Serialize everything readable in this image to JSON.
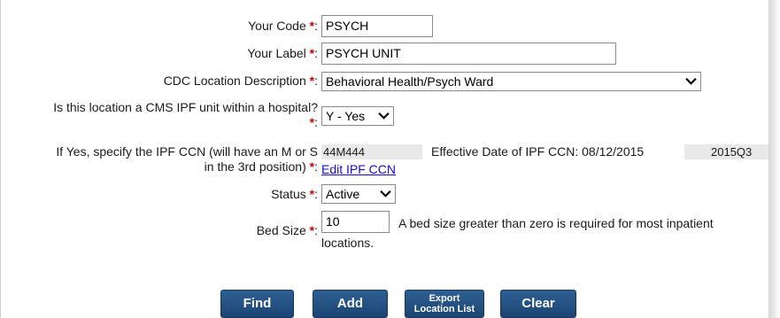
{
  "form": {
    "code": {
      "label": "Your Code",
      "value": "PSYCH"
    },
    "label": {
      "label": "Your Label",
      "value": "PSYCH UNIT"
    },
    "cdc": {
      "label": "CDC Location Description",
      "value": "Behavioral Health/Psych Ward"
    },
    "ipf": {
      "label_line1": "Is this location a CMS IPF unit within a hospital?",
      "value": "Y - Yes"
    },
    "ccn": {
      "label_line1": "If Yes, specify the IPF CCN (will have an M or S",
      "label_line2": "in the 3rd position)",
      "value": "44M444",
      "effective_label": "Effective Date of IPF CCN: 08/12/2015",
      "quarter": "2015Q3",
      "edit_link": "Edit IPF CCN"
    },
    "status": {
      "label": "Status",
      "value": "Active"
    },
    "bed_size": {
      "label": "Bed Size",
      "value": "10",
      "help_line1": "A bed size greater than zero is required for most inpatient",
      "help_line2": "locations."
    },
    "required_marker": "*",
    "colon": ":"
  },
  "buttons": {
    "find": "Find",
    "add": "Add",
    "export_line1": "Export",
    "export_line2": "Location List",
    "clear": "Clear"
  },
  "colors": {
    "required": "#cc0000",
    "button": "#1f4c7e",
    "link": "#1a0dcc"
  },
  "icons": {
    "select_arrow": "chevron-down-icon"
  }
}
